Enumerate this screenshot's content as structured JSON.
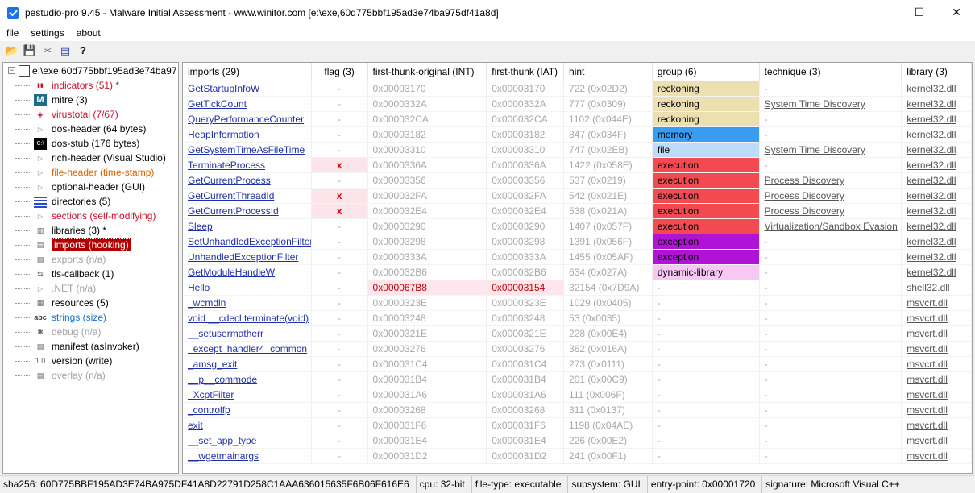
{
  "window": {
    "title": "pestudio-pro 9.45 - Malware Initial Assessment - www.winitor.com [e:\\exe,60d775bbf195ad3e74ba975df41a8d]",
    "minimize": "—",
    "maximize": "☐",
    "close": "✕"
  },
  "menu": [
    "file",
    "settings",
    "about"
  ],
  "toolbar": {
    "open_icon": "📂",
    "save_icon": "💾",
    "cut_icon": "✂",
    "list_icon": "▤",
    "help_icon": "?"
  },
  "tree": {
    "root": "e:\\exe,60d775bbf195ad3e74ba97",
    "items": [
      {
        "label": "indicators (51) *",
        "icon": "bars-icon",
        "color": "red"
      },
      {
        "label": "mitre (3)",
        "icon": "mitre-icon",
        "color": "normal"
      },
      {
        "label": "virustotal (7/67)",
        "icon": "shield-icon",
        "color": "red"
      },
      {
        "label": "dos-header (64 bytes)",
        "icon": "triangle-icon",
        "color": "normal"
      },
      {
        "label": "dos-stub (176 bytes)",
        "icon": "cmd-icon",
        "color": "normal"
      },
      {
        "label": "rich-header (Visual Studio)",
        "icon": "triangle-icon",
        "color": "normal"
      },
      {
        "label": "file-header (time-stamp)",
        "icon": "triangle-icon",
        "color": "orange"
      },
      {
        "label": "optional-header (GUI)",
        "icon": "triangle-icon",
        "color": "normal"
      },
      {
        "label": "directories (5)",
        "icon": "grid-icon",
        "color": "normal"
      },
      {
        "label": "sections (self-modifying)",
        "icon": "triangle-icon",
        "color": "red"
      },
      {
        "label": "libraries (3) *",
        "icon": "book-icon",
        "color": "normal"
      },
      {
        "label": "imports (hooking)",
        "icon": "document-icon",
        "color": "selected"
      },
      {
        "label": "exports (n/a)",
        "icon": "document-icon",
        "color": "grey"
      },
      {
        "label": "tls-callback (1)",
        "icon": "arrows-icon",
        "color": "normal"
      },
      {
        "label": ".NET (n/a)",
        "icon": "triangle-icon",
        "color": "grey"
      },
      {
        "label": "resources (5)",
        "icon": "folder-icon",
        "color": "normal"
      },
      {
        "label": "strings (size)",
        "icon": "abc-icon",
        "color": "blue"
      },
      {
        "label": "debug (n/a)",
        "icon": "bug-icon",
        "color": "grey"
      },
      {
        "label": "manifest (asInvoker)",
        "icon": "document-icon",
        "color": "normal"
      },
      {
        "label": "version (write)",
        "icon": "version-icon",
        "color": "normal"
      },
      {
        "label": "overlay (n/a)",
        "icon": "document-icon",
        "color": "grey"
      }
    ]
  },
  "table": {
    "headers": [
      "imports (29)",
      "flag (3)",
      "first-thunk-original (INT)",
      "first-thunk (IAT)",
      "hint",
      "group (6)",
      "technique (3)",
      "library (3)"
    ],
    "rows": [
      {
        "name": "GetStartupInfoW",
        "flag": "-",
        "int": "0x00003170",
        "iat": "0x00003170",
        "hint": "722 (0x02D2)",
        "group": "reckoning",
        "technique": "-",
        "library": "kernel32.dll"
      },
      {
        "name": "GetTickCount",
        "flag": "-",
        "int": "0x0000332A",
        "iat": "0x0000332A",
        "hint": "777 (0x0309)",
        "group": "reckoning",
        "technique": "System Time Discovery",
        "library": "kernel32.dll"
      },
      {
        "name": "QueryPerformanceCounter",
        "flag": "-",
        "int": "0x000032CA",
        "iat": "0x000032CA",
        "hint": "1102 (0x044E)",
        "group": "reckoning",
        "technique": "-",
        "library": "kernel32.dll"
      },
      {
        "name": "HeapInformation",
        "flag": "-",
        "int": "0x00003182",
        "iat": "0x00003182",
        "hint": "847 (0x034F)",
        "group": "memory",
        "technique": "-",
        "library": "kernel32.dll"
      },
      {
        "name": "GetSystemTimeAsFileTime",
        "flag": "-",
        "int": "0x00003310",
        "iat": "0x00003310",
        "hint": "747 (0x02EB)",
        "group": "file",
        "technique": "System Time Discovery",
        "library": "kernel32.dll"
      },
      {
        "name": "TerminateProcess",
        "flag": "x",
        "int": "0x0000336A",
        "iat": "0x0000336A",
        "hint": "1422 (0x058E)",
        "group": "execution",
        "technique": "-",
        "library": "kernel32.dll"
      },
      {
        "name": "GetCurrentProcess",
        "flag": "-",
        "int": "0x00003356",
        "iat": "0x00003356",
        "hint": "537 (0x0219)",
        "group": "execution",
        "technique": "Process Discovery",
        "library": "kernel32.dll"
      },
      {
        "name": "GetCurrentThreadId",
        "flag": "x",
        "int": "0x000032FA",
        "iat": "0x000032FA",
        "hint": "542 (0x021E)",
        "group": "execution",
        "technique": "Process Discovery",
        "library": "kernel32.dll"
      },
      {
        "name": "GetCurrentProcessId",
        "flag": "x",
        "int": "0x000032E4",
        "iat": "0x000032E4",
        "hint": "538 (0x021A)",
        "group": "execution",
        "technique": "Process Discovery",
        "library": "kernel32.dll"
      },
      {
        "name": "Sleep",
        "flag": "-",
        "int": "0x00003290",
        "iat": "0x00003290",
        "hint": "1407 (0x057F)",
        "group": "execution",
        "technique": "Virtualization/Sandbox Evasion",
        "library": "kernel32.dll"
      },
      {
        "name": "SetUnhandledExceptionFilter",
        "flag": "-",
        "int": "0x00003298",
        "iat": "0x00003298",
        "hint": "1391 (0x056F)",
        "group": "exception",
        "technique": "-",
        "library": "kernel32.dll"
      },
      {
        "name": "UnhandledExceptionFilter",
        "flag": "-",
        "int": "0x0000333A",
        "iat": "0x0000333A",
        "hint": "1455 (0x05AF)",
        "group": "exception",
        "technique": "-",
        "library": "kernel32.dll"
      },
      {
        "name": "GetModuleHandleW",
        "flag": "-",
        "int": "0x000032B6",
        "iat": "0x000032B6",
        "hint": "634 (0x027A)",
        "group": "dynamic-library",
        "technique": "-",
        "library": "kernel32.dll"
      },
      {
        "name": "Hello",
        "flag": "-",
        "int": "0x000067B8",
        "iat": "0x00003154",
        "hint": "32154 (0x7D9A)",
        "group": "-",
        "technique": "-",
        "library": "shell32.dll",
        "highlight": true
      },
      {
        "name": "_wcmdln",
        "flag": "-",
        "int": "0x0000323E",
        "iat": "0x0000323E",
        "hint": "1029 (0x0405)",
        "group": "-",
        "technique": "-",
        "library": "msvcrt.dll"
      },
      {
        "name": "void __cdecl terminate(void)",
        "flag": "-",
        "int": "0x00003248",
        "iat": "0x00003248",
        "hint": "53 (0x0035)",
        "group": "-",
        "technique": "-",
        "library": "msvcrt.dll"
      },
      {
        "name": "__setusermatherr",
        "flag": "-",
        "int": "0x0000321E",
        "iat": "0x0000321E",
        "hint": "228 (0x00E4)",
        "group": "-",
        "technique": "-",
        "library": "msvcrt.dll"
      },
      {
        "name": "_except_handler4_common",
        "flag": "-",
        "int": "0x00003276",
        "iat": "0x00003276",
        "hint": "362 (0x016A)",
        "group": "-",
        "technique": "-",
        "library": "msvcrt.dll"
      },
      {
        "name": "_amsg_exit",
        "flag": "-",
        "int": "0x000031C4",
        "iat": "0x000031C4",
        "hint": "273 (0x0111)",
        "group": "-",
        "technique": "-",
        "library": "msvcrt.dll"
      },
      {
        "name": "__p__commode",
        "flag": "-",
        "int": "0x000031B4",
        "iat": "0x000031B4",
        "hint": "201 (0x00C9)",
        "group": "-",
        "technique": "-",
        "library": "msvcrt.dll"
      },
      {
        "name": "_XcptFilter",
        "flag": "-",
        "int": "0x000031A6",
        "iat": "0x000031A6",
        "hint": "111 (0x006F)",
        "group": "-",
        "technique": "-",
        "library": "msvcrt.dll"
      },
      {
        "name": "_controlfp",
        "flag": "-",
        "int": "0x00003268",
        "iat": "0x00003268",
        "hint": "311 (0x0137)",
        "group": "-",
        "technique": "-",
        "library": "msvcrt.dll"
      },
      {
        "name": "exit",
        "flag": "-",
        "int": "0x000031F6",
        "iat": "0x000031F6",
        "hint": "1198 (0x04AE)",
        "group": "-",
        "technique": "-",
        "library": "msvcrt.dll"
      },
      {
        "name": "__set_app_type",
        "flag": "-",
        "int": "0x000031E4",
        "iat": "0x000031E4",
        "hint": "226 (0x00E2)",
        "group": "-",
        "technique": "-",
        "library": "msvcrt.dll"
      },
      {
        "name": "__wgetmainargs",
        "flag": "-",
        "int": "0x000031D2",
        "iat": "0x000031D2",
        "hint": "241 (0x00F1)",
        "group": "-",
        "technique": "-",
        "library": "msvcrt.dll"
      }
    ],
    "group_colors": {
      "reckoning": "#ece0b0",
      "memory": "#3a9cf0",
      "file": "#bcdcfa",
      "execution": "#f24a50",
      "exception": "#b012d6",
      "dynamic-library": "#f8c8f4"
    }
  },
  "status": {
    "sha256": "sha256: 60D775BBF195AD3E74BA975DF41A8D22791D258C1AAA636015635F6B06F616E6",
    "cpu": "cpu: 32-bit",
    "filetype": "file-type: executable",
    "subsystem": "subsystem: GUI",
    "entrypoint": "entry-point: 0x00001720",
    "signature": "signature: Microsoft Visual C++"
  }
}
